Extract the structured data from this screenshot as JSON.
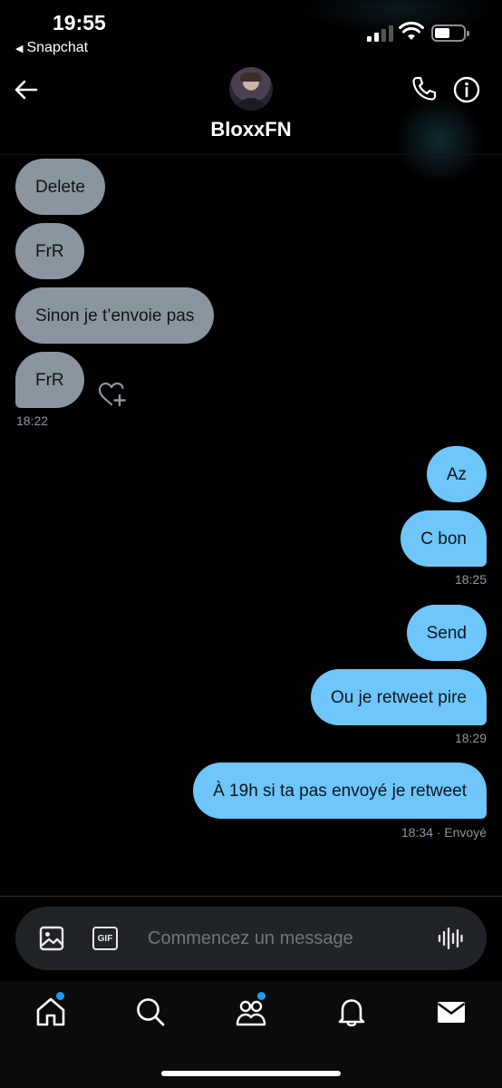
{
  "status_bar": {
    "time": "19:55",
    "back_app_label": "Snapchat"
  },
  "header": {
    "contact_name": "BloxxFN"
  },
  "messages": {
    "received": [
      {
        "text": "Delete"
      },
      {
        "text": "FrR"
      },
      {
        "text": "Sinon je t’envoie pas"
      },
      {
        "text": "FrR"
      }
    ],
    "received_time": "18:22",
    "sent": [
      {
        "text": "Az"
      },
      {
        "text": "C bon"
      },
      {
        "text": "Send"
      },
      {
        "text": "Ou je retweet pire"
      },
      {
        "text": "À 19h si ta pas envoyé je retweet"
      }
    ],
    "sent_times": [
      "18:25",
      "18:29",
      "18:34 · Envoyé"
    ]
  },
  "composer": {
    "placeholder": "Commencez un message",
    "gif_label": "GIF"
  },
  "colors": {
    "received_bubble": "#8b959e",
    "sent_bubble": "#6ec6fb",
    "accent": "#1d9bf0",
    "background": "#000000"
  },
  "icons": [
    "back-arrow-icon",
    "phone-icon",
    "info-icon",
    "heart-plus-icon",
    "image-icon",
    "gif-icon",
    "voice-icon",
    "home-icon",
    "search-icon",
    "communities-icon",
    "bell-icon",
    "mail-icon"
  ]
}
